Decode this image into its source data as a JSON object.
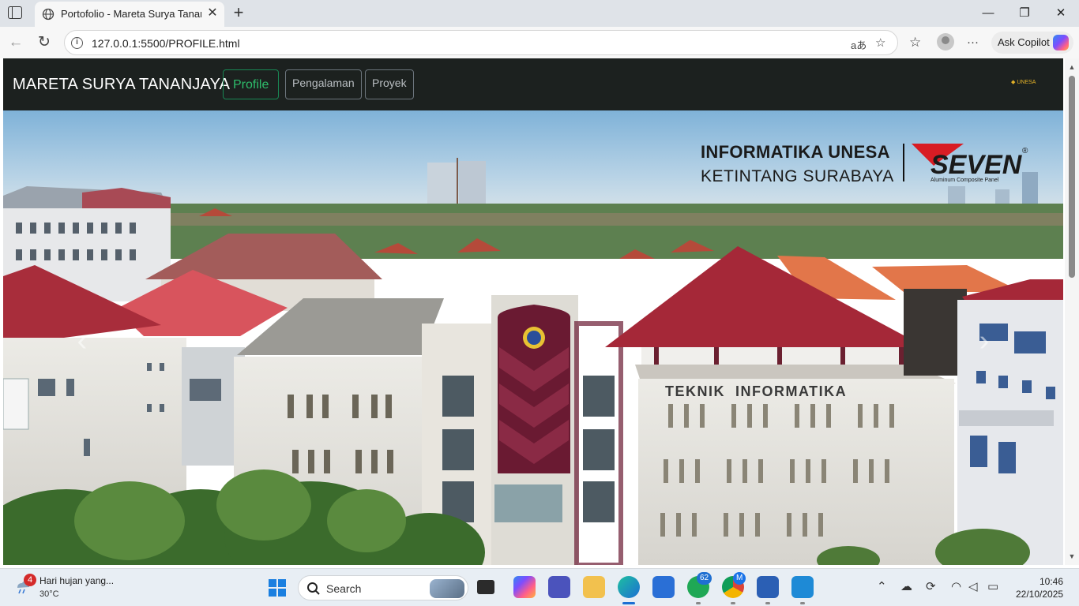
{
  "browser": {
    "tab_title": "Portofolio - Mareta Surya Tananjaya",
    "url": "127.0.0.1:5500/PROFILE.html",
    "ask_copilot_label": "Ask Copilot",
    "read_aloud_glyph": "aあ",
    "more_glyph": "···",
    "new_tab_glyph": "+",
    "close_glyph": "✕",
    "minimize_glyph": "—",
    "maximize_glyph": "❐",
    "window_close_glyph": "✕"
  },
  "site": {
    "brand": "MARETA SURYA TANANJAYA",
    "nav": [
      {
        "label": "Profile",
        "active": true
      },
      {
        "label": "Pengalaman",
        "active": false
      },
      {
        "label": "Proyek",
        "active": false
      }
    ],
    "logo_text": "UNESA"
  },
  "hero": {
    "headline_1": "INFORMATIKA UNESA",
    "headline_2": "KETINTANG SURABAYA",
    "sponsor_name": "SEVEN",
    "sponsor_tagline": "Aluminum Composite Panel",
    "sponsor_mark": "®",
    "building_sign": "TEKNIK  INFORMATIKA",
    "prev_glyph": "‹",
    "next_glyph": "›"
  },
  "taskbar": {
    "weather_text": "Hari hujan yang...",
    "weather_temp": "30°C",
    "weather_badge": "4",
    "search_label": "Search",
    "whatsapp_badge": "62",
    "chrome_badge": "M",
    "time": "10:46",
    "date": "22/10/2025"
  },
  "colors": {
    "navbar_bg": "#1c211f",
    "active_nav": "#198754",
    "accent": "#1b6fd3"
  }
}
